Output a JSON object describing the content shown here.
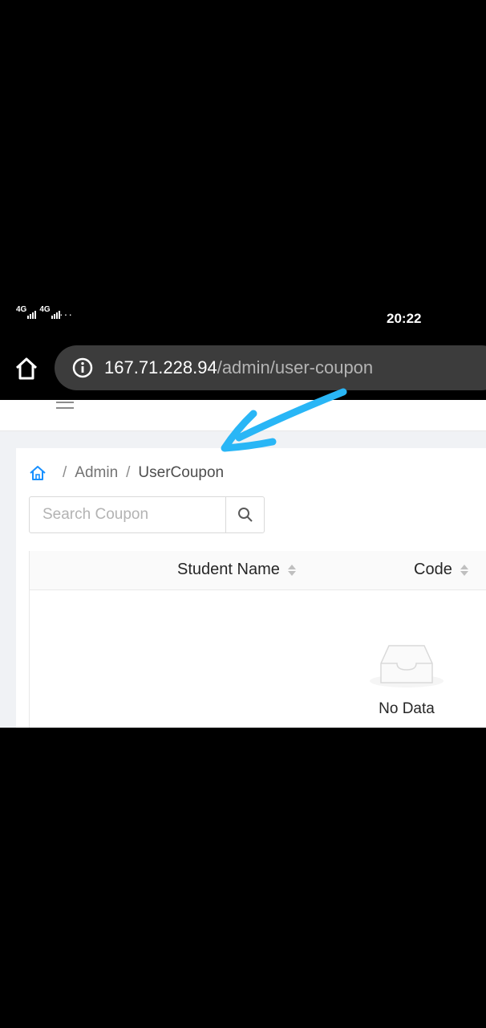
{
  "status_bar": {
    "signal_1": "4G",
    "signal_2": "4G",
    "more_indicator": "···",
    "time": "20:22"
  },
  "browser": {
    "url_host": "167.71.228.94",
    "url_path": "/admin/user-coupon"
  },
  "breadcrumb": {
    "items": [
      "Admin",
      "UserCoupon"
    ],
    "separator": "/"
  },
  "search": {
    "placeholder": "Search Coupon",
    "value": ""
  },
  "table": {
    "columns": [
      "Student Name",
      "Code"
    ],
    "empty_text": "No Data"
  },
  "colors": {
    "annotation_arrow": "#29b6f6",
    "home_icon": "#1890ff",
    "url_bar": "#3c3c3c"
  }
}
